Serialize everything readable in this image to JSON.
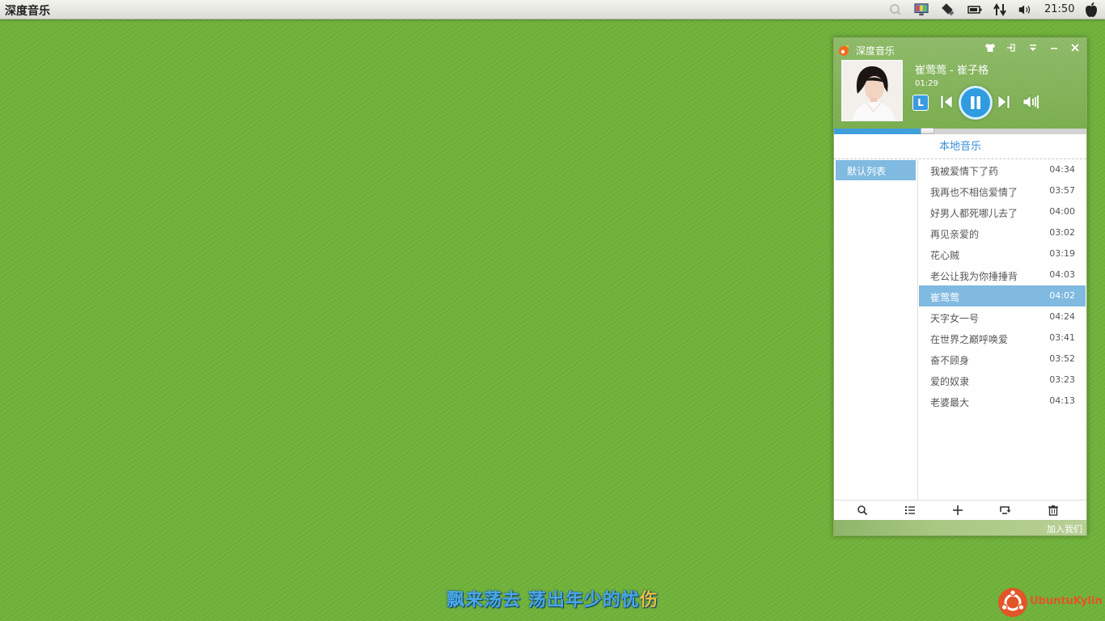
{
  "top_panel": {
    "app_title": "深度音乐",
    "clock": "21:50",
    "tray_icons": [
      "search-icon",
      "monitor-icon",
      "usb-drive-icon",
      "battery-icon",
      "network-icon",
      "volume-icon",
      "apple-icon"
    ]
  },
  "player": {
    "window_title": "深度音乐",
    "window_buttons": [
      "skin-icon",
      "mini-mode-icon",
      "menu-icon",
      "minimize-icon",
      "close-icon"
    ],
    "now_playing": {
      "title": "崔莺莺 - 崔子格",
      "time": "01:29",
      "lyric_badge": "L",
      "progress": 0.37
    },
    "section_title": "本地音乐",
    "playlists": [
      {
        "label": "默认列表",
        "selected": true
      }
    ],
    "tracks": [
      {
        "title": "我被爱情下了药",
        "duration": "04:34"
      },
      {
        "title": "我再也不相信爱情了",
        "duration": "03:57"
      },
      {
        "title": "好男人都死哪儿去了",
        "duration": "04:00"
      },
      {
        "title": "再见亲爱的",
        "duration": "03:02"
      },
      {
        "title": "花心贼",
        "duration": "03:19"
      },
      {
        "title": "老公让我为你捶捶背",
        "duration": "04:03"
      },
      {
        "title": "崔莺莺",
        "duration": "04:02",
        "active": true
      },
      {
        "title": "天字女一号",
        "duration": "04:24"
      },
      {
        "title": "在世界之巅呼唤爱",
        "duration": "03:41"
      },
      {
        "title": "奋不顾身",
        "duration": "03:52"
      },
      {
        "title": "爱的奴隶",
        "duration": "03:23"
      },
      {
        "title": "老婆最大",
        "duration": "04:13"
      }
    ],
    "toolbar": [
      "search-icon",
      "list-icon",
      "add-icon",
      "loop-icon",
      "delete-icon"
    ],
    "footer_link": "加入我们"
  },
  "desktop_lyric": {
    "sung": "飘来荡去 荡出年少的忧",
    "unsung": "伤"
  },
  "distro_logo_text": "UbuntuKylin",
  "colors": {
    "desktop": "#70b23a",
    "selection": "#80bae0",
    "accent_blue": "#3f9fdc",
    "lyric_blue": "#4aa8e6",
    "lyric_gold": "#e8c040",
    "logo_orange": "#e25528"
  }
}
